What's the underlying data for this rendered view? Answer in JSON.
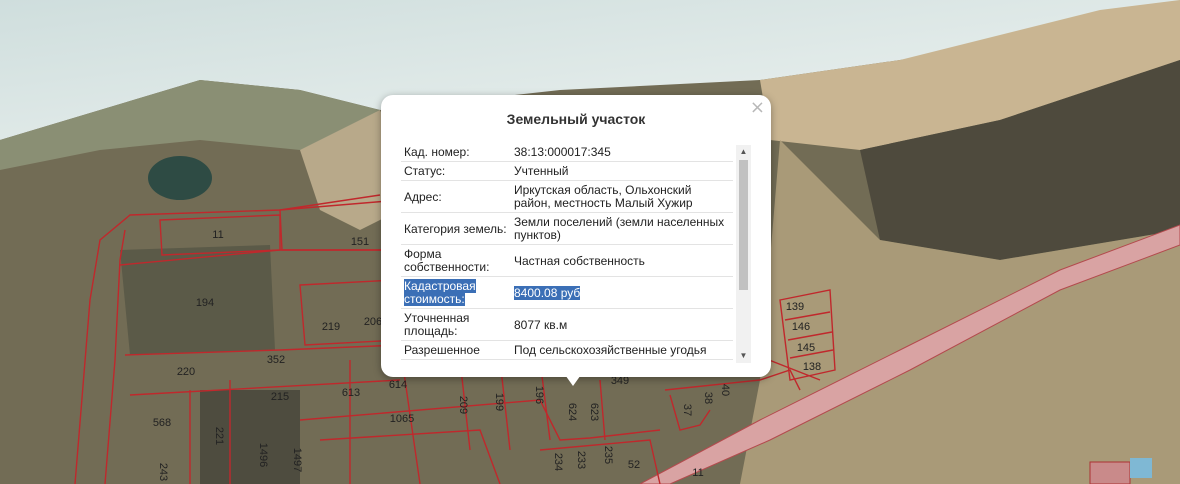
{
  "popup": {
    "title": "Земельный участок",
    "close": "×",
    "rows": [
      {
        "key": "Кад. номер:",
        "value": "38:13:000017:345"
      },
      {
        "key": "Статус:",
        "value": "Учтенный"
      },
      {
        "key": "Адрес:",
        "value": "Иркутская область, Ольхонский район, местность Малый Хужир"
      },
      {
        "key": "Категория земель:",
        "value": "Земли поселений (земли населенных пунктов)"
      },
      {
        "key": "Форма собственности:",
        "value": "Частная собственность"
      },
      {
        "key": "Кадастровая стоимость:",
        "value": "8400.08 руб"
      },
      {
        "key": "Уточненная площадь:",
        "value": "8077 кв.м"
      },
      {
        "key": "Разрешенное",
        "value": "Под сельскохозяйственные угодья"
      }
    ],
    "scroll_up": "▲",
    "scroll_down": "▼"
  },
  "plots": [
    "11",
    "151",
    "194",
    "219",
    "206",
    "352",
    "220",
    "215",
    "613",
    "614",
    "568",
    "221",
    "1496",
    "1497",
    "1065",
    "209",
    "199",
    "196",
    "624",
    "623",
    "349",
    "234",
    "233",
    "235",
    "52",
    "243",
    "139",
    "146",
    "145",
    "138",
    "37",
    "38",
    "40",
    "11"
  ],
  "colors": {
    "boundary": "#c0282c",
    "road": "#d9a3a3",
    "popup_highlight": "#3b6fb6"
  }
}
